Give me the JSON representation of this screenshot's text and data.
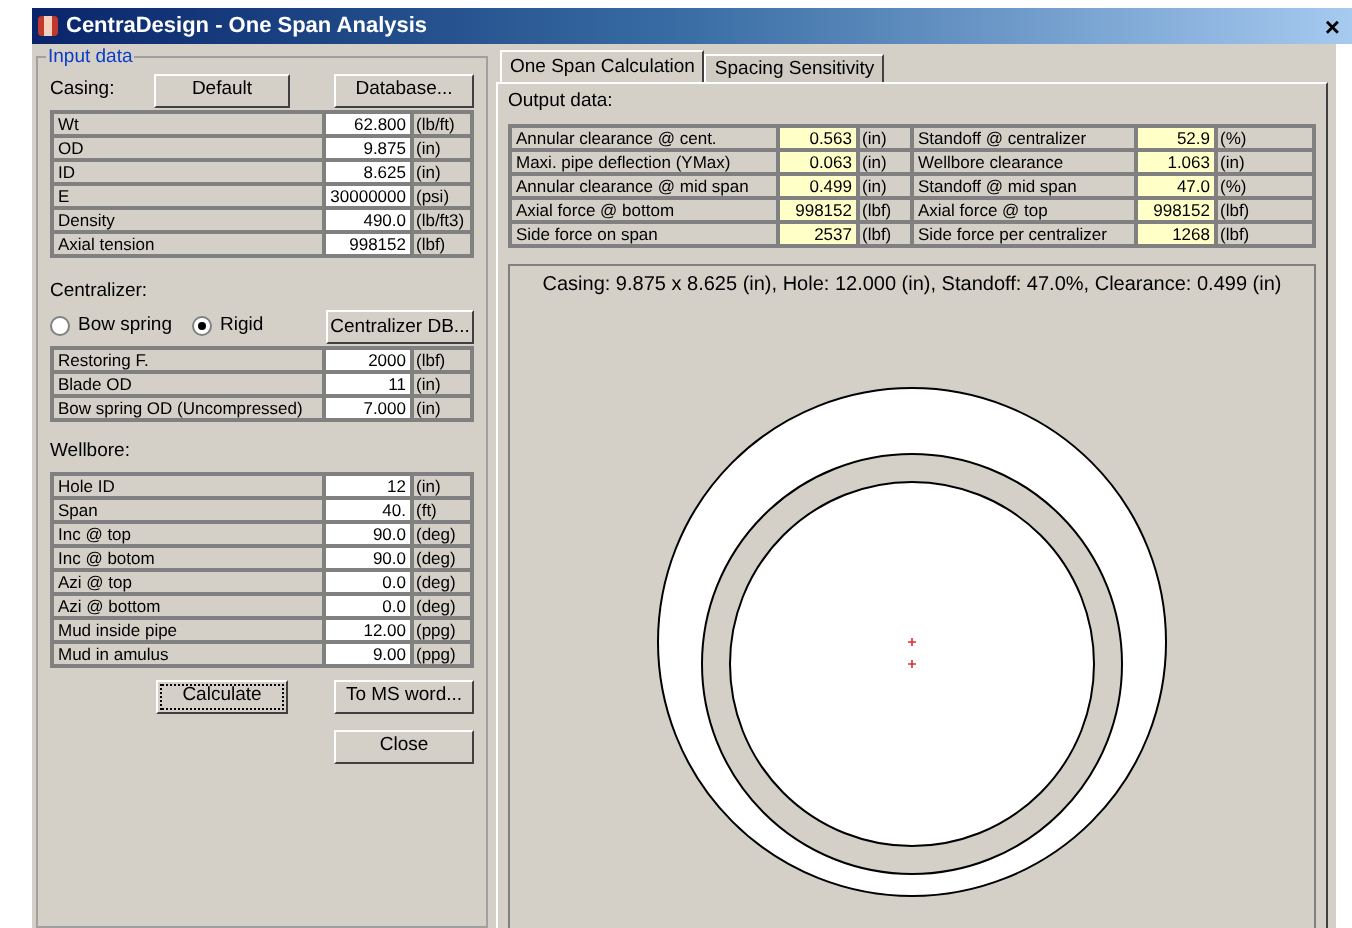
{
  "window": {
    "title": "CentraDesign - One Span Analysis",
    "close": "×"
  },
  "input": {
    "legend": "Input data",
    "casing": {
      "label": "Casing:",
      "buttons": [
        "Default",
        "Database..."
      ],
      "rows": [
        {
          "label": "Wt",
          "value": "62.800",
          "unit": "(lb/ft)"
        },
        {
          "label": "OD",
          "value": "9.875",
          "unit": "(in)"
        },
        {
          "label": "ID",
          "value": "8.625",
          "unit": "(in)"
        },
        {
          "label": "E",
          "value": "30000000",
          "unit": "(psi)"
        },
        {
          "label": "Density",
          "value": "490.0",
          "unit": "(lb/ft3)"
        },
        {
          "label": "Axial tension",
          "value": "998152",
          "unit": "(lbf)"
        }
      ]
    },
    "centralizer": {
      "label": "Centralizer:",
      "options": [
        {
          "label": "Bow spring",
          "selected": false
        },
        {
          "label": "Rigid",
          "selected": true
        }
      ],
      "button": "Centralizer DB...",
      "rows": [
        {
          "label": "Restoring F.",
          "value": "2000",
          "unit": "(lbf)"
        },
        {
          "label": "Blade OD",
          "value": "11",
          "unit": "(in)"
        },
        {
          "label": "Bow spring OD (Uncompressed)",
          "value": "7.000",
          "unit": "(in)"
        }
      ]
    },
    "wellbore": {
      "label": "Wellbore:",
      "rows": [
        {
          "label": "Hole ID",
          "value": "12",
          "unit": "(in)"
        },
        {
          "label": "Span",
          "value": "40.",
          "unit": "(ft)"
        },
        {
          "label": "Inc @ top",
          "value": "90.0",
          "unit": "(deg)"
        },
        {
          "label": "Inc @ botom",
          "value": "90.0",
          "unit": "(deg)"
        },
        {
          "label": "Azi @ top",
          "value": "0.0",
          "unit": "(deg)"
        },
        {
          "label": "Azi @ bottom",
          "value": "0.0",
          "unit": "(deg)"
        },
        {
          "label": "Mud inside pipe",
          "value": "12.00",
          "unit": "(ppg)"
        },
        {
          "label": "Mud in amulus",
          "value": "9.00",
          "unit": "(ppg)"
        }
      ]
    },
    "buttons": {
      "calculate": "Calculate",
      "word": "To MS word...",
      "close": "Close"
    }
  },
  "tabs": [
    {
      "label": "One Span Calculation",
      "selected": true
    },
    {
      "label": "Spacing Sensitivity",
      "selected": false
    }
  ],
  "output": {
    "label": "Output data:",
    "rows": [
      [
        {
          "label": "Annular clearance @ cent.",
          "value": "0.563",
          "unit": "(in)"
        },
        {
          "label": "Standoff @ centralizer",
          "value": "52.9",
          "unit": "(%)"
        }
      ],
      [
        {
          "label": "Maxi. pipe deflection (YMax)",
          "value": "0.063",
          "unit": "(in)"
        },
        {
          "label": "Wellbore clearance",
          "value": "1.063",
          "unit": "(in)"
        }
      ],
      [
        {
          "label": "Annular clearance @ mid span",
          "value": "0.499",
          "unit": "(in)"
        },
        {
          "label": "Standoff @ mid span",
          "value": "47.0",
          "unit": "(%)"
        }
      ],
      [
        {
          "label": "Axial force @ bottom",
          "value": "998152",
          "unit": "(lbf)"
        },
        {
          "label": "Axial force @ top",
          "value": "998152",
          "unit": "(lbf)"
        }
      ],
      [
        {
          "label": "Side force on span",
          "value": "2537",
          "unit": "(lbf)"
        },
        {
          "label": "Side force per centralizer",
          "value": "1268",
          "unit": "(lbf)"
        }
      ]
    ],
    "caption": "Casing: 9.875 x 8.625 (in), Hole: 12.000 (in), Standoff: 47.0%, Clearance: 0.499 (in)"
  }
}
